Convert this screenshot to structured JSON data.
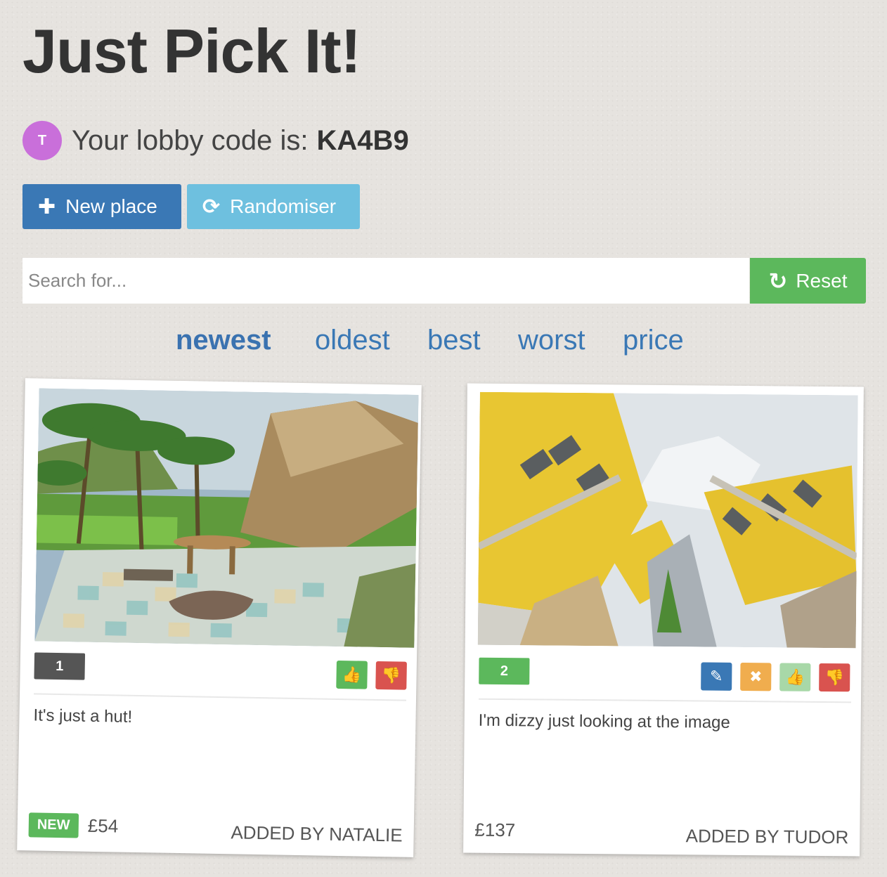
{
  "app": {
    "title": "Just Pick It!"
  },
  "lobby": {
    "avatar_initial": "T",
    "prefix": "Your lobby code is:",
    "code": "KA4B9",
    "avatar_color": "#c96fda"
  },
  "toolbar": {
    "new_place_label": "New place",
    "randomiser_label": "Randomiser"
  },
  "search": {
    "placeholder": "Search for...",
    "value": "",
    "reset_label": "Reset"
  },
  "sort": {
    "options": [
      "newest",
      "oldest",
      "best",
      "worst",
      "price"
    ],
    "active": "newest"
  },
  "cards": [
    {
      "rank": "1",
      "image": "tropical thatched hut with palm trees and tiled patio",
      "description": "It's just a hut!",
      "badge": "NEW",
      "price": "£54",
      "added_by": "ADDED BY NATALIE",
      "actions": [
        "thumbs-up",
        "thumbs-down"
      ]
    },
    {
      "rank": "2",
      "image": "yellow tilted cube houses",
      "description": "I'm dizzy just looking at the image",
      "badge": "",
      "price": "£137",
      "added_by": "ADDED BY TUDOR",
      "actions": [
        "edit",
        "delete",
        "thumbs-up",
        "thumbs-down"
      ]
    }
  ],
  "colors": {
    "primary": "#3a78b5",
    "info": "#6ec0df",
    "success": "#5cb85c",
    "warning": "#f0ad4e",
    "danger": "#d9534f",
    "success_light": "#a8d8a8"
  }
}
